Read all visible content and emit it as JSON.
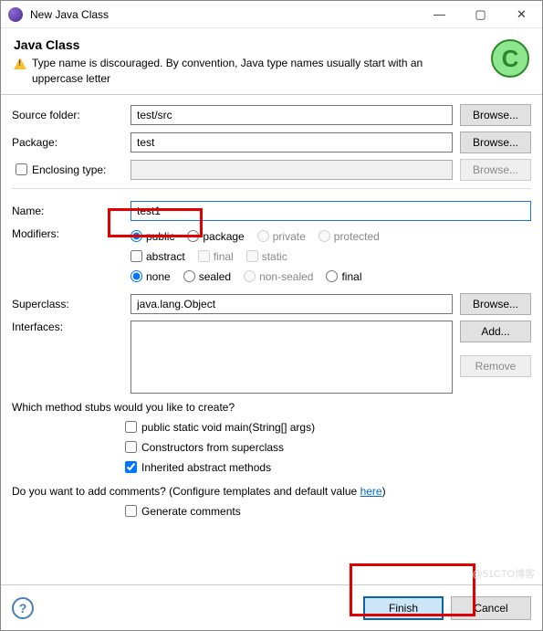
{
  "window": {
    "title": "New Java Class"
  },
  "banner": {
    "title": "Java Class",
    "warning": "Type name is discouraged. By convention, Java type names usually start with an uppercase letter"
  },
  "labels": {
    "source_folder": "Source folder:",
    "package": "Package:",
    "enclosing_type": "Enclosing type:",
    "name": "Name:",
    "modifiers": "Modifiers:",
    "superclass": "Superclass:",
    "interfaces": "Interfaces:"
  },
  "values": {
    "source_folder": "test/src",
    "package": "test",
    "enclosing_type": "",
    "name": "test1",
    "superclass": "java.lang.Object"
  },
  "buttons": {
    "browse": "Browse...",
    "add": "Add...",
    "remove": "Remove",
    "finish": "Finish",
    "cancel": "Cancel"
  },
  "modifiers": {
    "public": "public",
    "package": "package",
    "private": "private",
    "protected": "protected",
    "abstract": "abstract",
    "final": "final",
    "static": "static",
    "none": "none",
    "sealed": "sealed",
    "non_sealed": "non-sealed",
    "final2": "final"
  },
  "stubs": {
    "question": "Which method stubs would you like to create?",
    "main": "public static void main(String[] args)",
    "constructors": "Constructors from superclass",
    "inherited": "Inherited abstract methods"
  },
  "comments": {
    "question_pre": "Do you want to add comments? (Configure templates and default value ",
    "here": "here",
    "question_post": ")",
    "generate": "Generate comments"
  },
  "watermark": "@51CTO博客"
}
